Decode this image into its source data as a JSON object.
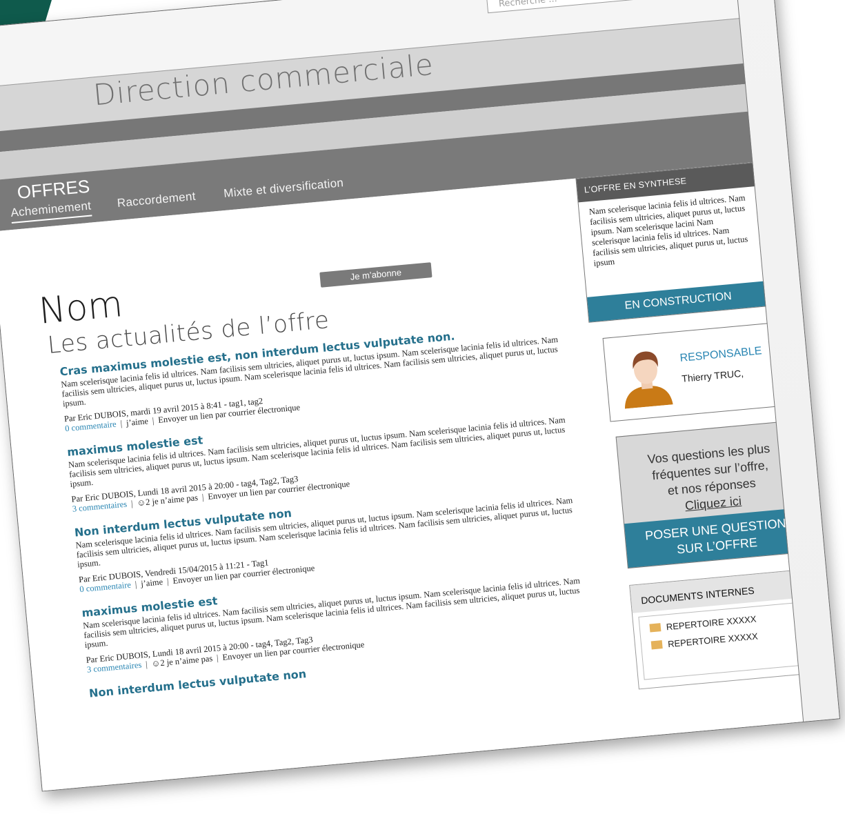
{
  "header": {
    "title": "Direction commerciale",
    "search_placeholder": "Recherche ..."
  },
  "nav": {
    "section_title": "OFFRES",
    "tabs": [
      {
        "label": "Acheminement",
        "active": true
      },
      {
        "label": "Raccordement",
        "active": false
      },
      {
        "label": "Mixte et diversification",
        "active": false
      }
    ]
  },
  "main": {
    "title": "Nom",
    "subscribe_label": "Je m’abonne",
    "section_title": "Les actualités de l’offre",
    "posts": [
      {
        "title": "Cras maximus molestie est, non interdum lectus vulputate non.",
        "body": "Nam scelerisque lacinia felis id ultrices. Nam facilisis sem ultricies, aliquet purus ut, luctus ipsum. Nam scelerisque lacinia felis id ultrices. Nam facilisis sem ultricies, aliquet purus ut, luctus ipsum. Nam scelerisque lacinia felis id ultrices. Nam facilisis sem ultricies, aliquet purus ut, luctus ipsum.",
        "meta": "Par Eric DUBOIS, mardi 19 avril 2015 à 8:41  - tag1, tag2",
        "comments": "0 commentaire",
        "likes": "j’aime",
        "share": "Envoyer un lien par courrier électronique"
      },
      {
        "title": "maximus molestie est",
        "body": "Nam scelerisque lacinia felis id ultrices. Nam facilisis sem ultricies, aliquet purus ut, luctus ipsum. Nam scelerisque lacinia felis id ultrices. Nam facilisis sem ultricies, aliquet purus ut, luctus ipsum. Nam scelerisque lacinia felis id ultrices. Nam facilisis sem ultricies, aliquet purus ut, luctus ipsum.",
        "meta": "Par Eric DUBOIS, Lundi 18 avril 2015 à 20:00  - tag4, Tag2, Tag3",
        "comments": "3 commentaires",
        "likes": "☺2  je n’aime pas",
        "share": "Envoyer un lien par courrier électronique"
      },
      {
        "title": "Non interdum lectus vulputate non",
        "body": "Nam scelerisque lacinia felis id ultrices. Nam facilisis sem ultricies, aliquet purus ut, luctus ipsum. Nam scelerisque lacinia felis id ultrices. Nam facilisis sem ultricies, aliquet purus ut, luctus ipsum. Nam scelerisque lacinia felis id ultrices. Nam facilisis sem ultricies, aliquet purus ut, luctus ipsum.",
        "meta": "Par Eric DUBOIS, Vendredi 15/04/2015 à 11:21  - Tag1",
        "comments": "0 commentaire",
        "likes": "j’aime",
        "share": "Envoyer un lien par courrier électronique"
      },
      {
        "title": "maximus molestie est",
        "body": "Nam scelerisque lacinia felis id ultrices. Nam facilisis sem ultricies, aliquet purus ut, luctus ipsum. Nam scelerisque lacinia felis id ultrices. Nam facilisis sem ultricies, aliquet purus ut, luctus ipsum. Nam scelerisque lacinia felis id ultrices. Nam facilisis sem ultricies, aliquet purus ut, luctus ipsum.",
        "meta": "Par Eric DUBOIS, Lundi 18 avril 2015 à 20:00  - tag4, Tag2, Tag3",
        "comments": "3 commentaires",
        "likes": "☺2  je n’aime pas",
        "share": "Envoyer un lien par courrier électronique"
      },
      {
        "title": "Non interdum lectus vulputate non",
        "body": "",
        "meta": "",
        "comments": "",
        "likes": "",
        "share": ""
      }
    ]
  },
  "sidebar": {
    "synthese": {
      "header": "L’OFFRE EN SYNTHESE",
      "text": "Nam scelerisque lacinia felis id ultrices. Nam facilisis sem ultricies, aliquet purus ut, luctus ipsum. Nam scelerisque lacini Nam scelerisque lacinia felis id ultrices. Nam facilisis sem ultricies, aliquet purus ut, luctus ipsum",
      "footer": "EN CONSTRUCTION"
    },
    "responsable": {
      "label": "RESPONSABLE",
      "name": "Thierry TRUC,"
    },
    "faq": {
      "line1": "Vos questions les plus",
      "line2": "fréquentes sur l’offre,",
      "line3": "et  nos réponses",
      "link": "Cliquez ici",
      "button_line1": "POSER UNE QUESTION",
      "button_line2": "SUR L’OFFRE"
    },
    "docs": {
      "header": "DOCUMENTS INTERNES",
      "items": [
        "REPERTOIRE XXXXX",
        "REPERTOIRE XXXXX"
      ]
    }
  },
  "colors": {
    "accent": "#2e7f9a",
    "link": "#2a86b3",
    "brand_corner": "#0f5a4c"
  }
}
